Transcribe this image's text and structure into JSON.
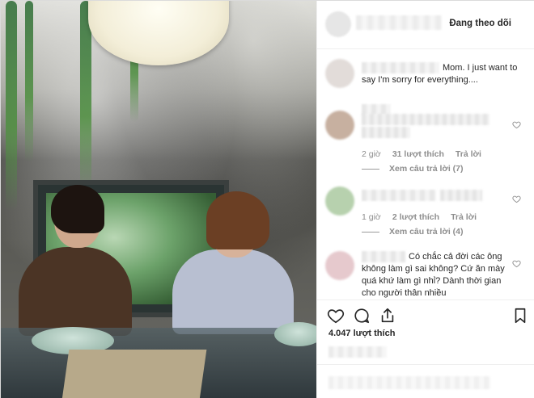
{
  "header": {
    "follow_status": "Đang theo dõi"
  },
  "caption": {
    "text": "Mom. I just want to say I'm sorry for everything...."
  },
  "comments": [
    {
      "time": "2 giờ",
      "likes": "31 lượt thích",
      "reply": "Trả lời",
      "view_replies": "Xem câu trả lời (7)"
    },
    {
      "time": "1 giờ",
      "likes": "2 lượt thích",
      "reply": "Trả lời",
      "view_replies": "Xem câu trả lời (4)"
    },
    {
      "text": "Có chắc cả đời các ông không làm gì sai không? Cứ ăn mày quá khứ làm gì nhỉ? Dành thời gian cho người thân nhiều"
    }
  ],
  "post": {
    "likes": "4.047 lượt thích"
  },
  "icons": {
    "like": "heart-icon",
    "comment": "comment-icon",
    "share": "share-icon",
    "save": "bookmark-icon"
  },
  "colors": {
    "text": "#262626",
    "muted": "#8e8e8e",
    "border": "#efefef"
  }
}
